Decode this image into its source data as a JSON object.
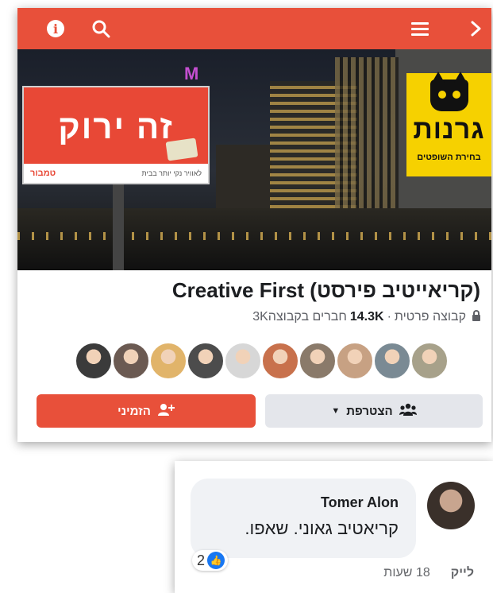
{
  "group": {
    "title": "(קריאייטיב פירסט) Creative First",
    "privacy": "קבוצה פרטית",
    "members_count": "14.3K",
    "members_suffix": "חברים בקבוצה3K",
    "join_label": "הצטרפת",
    "invite_label": "הזמיני"
  },
  "cover": {
    "billboard_headline": "זה ירוק",
    "billboard_tagline": "לאוויר נקי יותר בבית",
    "billboard_brand": "טמבור",
    "m_logo": "M",
    "badge_title": "גרנות",
    "badge_subtitle": "בחירת השופטים"
  },
  "comment": {
    "author": "Tomer Alon",
    "text": "קריאטיב גאוני. שאפו.",
    "reaction_count": "2",
    "like_label": "לייק",
    "time": "18 שעות"
  },
  "avatars": [
    {
      "color": "#3b3b3b"
    },
    {
      "color": "#6b5a52"
    },
    {
      "color": "#e1b46a"
    },
    {
      "color": "#4c4c4c"
    },
    {
      "color": "#d7d7d7"
    },
    {
      "color": "#c8714c"
    },
    {
      "color": "#8a7a6a"
    },
    {
      "color": "#c7a183"
    },
    {
      "color": "#7a8a94"
    },
    {
      "color": "#a7a18a"
    }
  ],
  "colors": {
    "accent": "#e8503a",
    "like_blue": "#1877f2"
  },
  "icons": {
    "top_left_1": "info-icon",
    "top_left_2": "search-icon",
    "top_right_1": "menu-icon",
    "top_right_2": "chevron-right-icon"
  }
}
